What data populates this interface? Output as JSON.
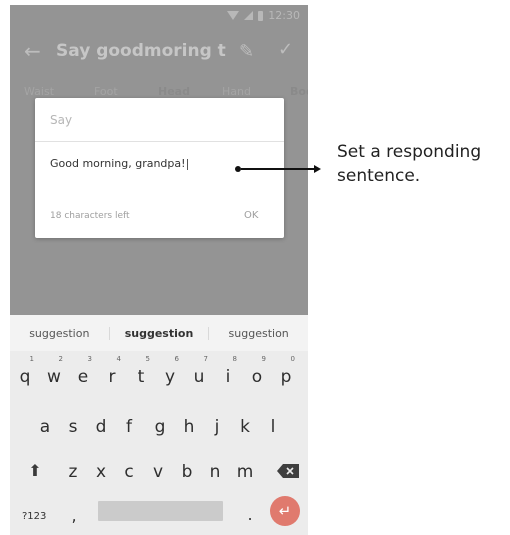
{
  "status_bar": {
    "time": "12:30"
  },
  "toolbar": {
    "title": "Say goodmoring to..."
  },
  "tabs": [
    "Waist",
    "Foot",
    "Head",
    "Hand",
    "Bod"
  ],
  "dialog": {
    "title": "Say",
    "text": "Good morning, grandpa!",
    "char_count": "18 characters left",
    "ok_label": "OK"
  },
  "callout": {
    "text": "Set a responding sentence."
  },
  "suggestions": [
    "suggestion",
    "suggestion",
    "suggestion"
  ],
  "keyboard": {
    "row1": [
      "q",
      "w",
      "e",
      "r",
      "t",
      "y",
      "u",
      "i",
      "o",
      "p"
    ],
    "row1_numbers": [
      "1",
      "2",
      "3",
      "4",
      "5",
      "6",
      "7",
      "8",
      "9",
      "0"
    ],
    "row2": [
      "a",
      "s",
      "d",
      "f",
      "g",
      "h",
      "j",
      "k",
      "l"
    ],
    "row3": [
      "z",
      "x",
      "c",
      "v",
      "b",
      "n",
      "m"
    ],
    "symbols_label": "?123",
    "comma": ",",
    "period": "."
  },
  "colors": {
    "enter_key": "#e07a6e",
    "overlay": "#949494"
  }
}
